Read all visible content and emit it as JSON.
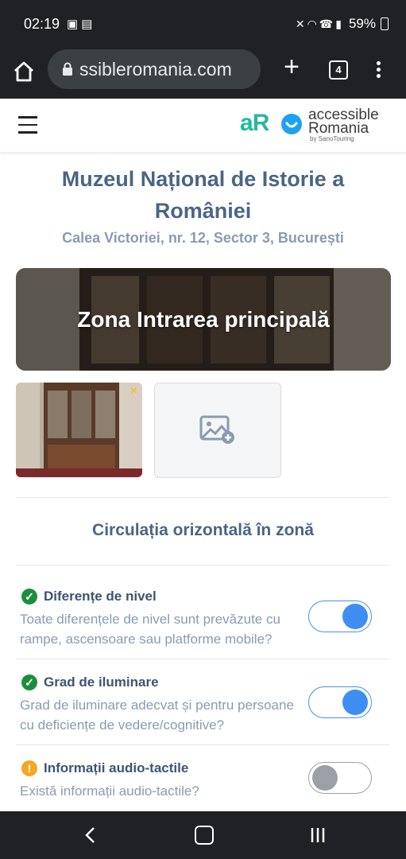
{
  "status_bar": {
    "time": "02:19",
    "left_icons": [
      "gallery-icon",
      "cast-icon"
    ],
    "right_icons": [
      "mute-icon",
      "wifi-icon",
      "call-signal-icon",
      "signal-icon"
    ],
    "battery": "59%"
  },
  "browser": {
    "url": "ssibleromania.com",
    "tab_count": "4"
  },
  "site": {
    "logo_mark": "aR",
    "logo_line1": "accessible",
    "logo_line2": "Romania",
    "logo_byline": "by SanoTouring"
  },
  "page": {
    "title": "Muzeul Național de Istorie a României",
    "address": "Calea Victoriei, nr. 12, Sector 3, București",
    "zone_label": "Zona Intrarea principală",
    "section_title": "Circulația orizontală în zonă"
  },
  "items": [
    {
      "name": "Diferențe de nivel",
      "description": "Toate diferențele de nivel sunt prevăzute cu rampe, ascensoare sau platforme mobile?",
      "status": "ok",
      "toggle": true
    },
    {
      "name": "Grad de iluminare",
      "description": "Grad de iluminare adecvat și pentru persoane cu deficiențe de vedere/cognitive?",
      "status": "ok",
      "toggle": true
    },
    {
      "name": "Informații audio-tactile",
      "description": "Există informații audio-tactile?",
      "status": "warning",
      "toggle": false
    }
  ],
  "colors": {
    "accent": "#3d8ef0",
    "title": "#4a6585",
    "ok": "#1e8e3e",
    "warning": "#f5a623"
  }
}
